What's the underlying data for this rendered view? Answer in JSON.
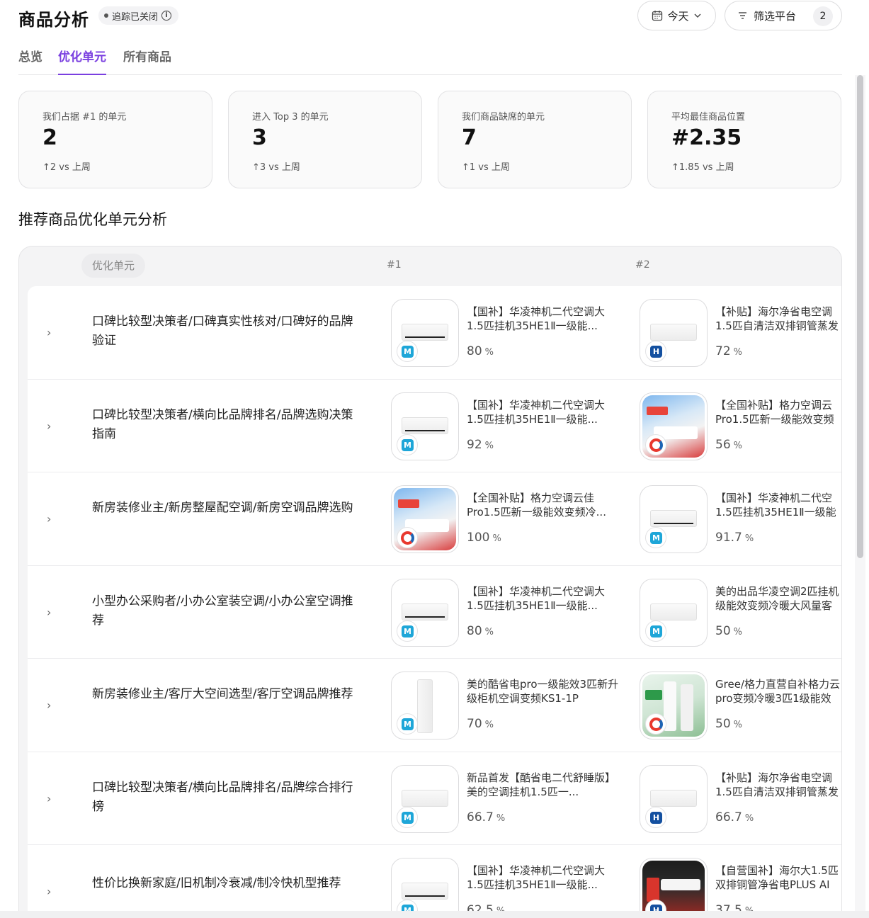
{
  "header": {
    "title": "商品分析",
    "tracking_status": "追踪已关闭",
    "date_filter": "今天",
    "platform_filter": "筛选平台",
    "platform_count": "2"
  },
  "tabs": [
    {
      "label": "总览",
      "active": false
    },
    {
      "label": "优化单元",
      "active": true
    },
    {
      "label": "所有商品",
      "active": false
    }
  ],
  "stats": [
    {
      "label": "我们占据 #1 的单元",
      "value": "2",
      "delta": "↑2 vs 上周"
    },
    {
      "label": "进入 Top 3 的单元",
      "value": "3",
      "delta": "↑3 vs 上周"
    },
    {
      "label": "我们商品缺席的单元",
      "value": "7",
      "delta": "↑1 vs 上周"
    },
    {
      "label": "平均最佳商品位置",
      "value": "#2.35",
      "delta": "↑1.85 vs 上周"
    }
  ],
  "section_title": "推荐商品优化单元分析",
  "table": {
    "col_unit": "优化单元",
    "col_1": "#1",
    "col_2": "#2",
    "rows": [
      {
        "unit": "口碑比较型决策者/口碑真实性核对/口碑好的品牌验证",
        "p1": {
          "title": "【国补】华凌神机二代空调大1.5匹挂机35HE1Ⅱ一级能...",
          "score": "80",
          "pct": "%",
          "brand": "midea",
          "img": "ac"
        },
        "p2": {
          "title": "【补贴】海尔净省电空调1.5匹自清洁双排铜管蒸发",
          "score": "72",
          "pct": "%",
          "brand": "haier",
          "img": "ac-plain"
        }
      },
      {
        "unit": "口碑比较型决策者/横向比品牌排名/品牌选购决策指南",
        "p1": {
          "title": "【国补】华凌神机二代空调大1.5匹挂机35HE1Ⅱ一级能...",
          "score": "92",
          "pct": "%",
          "brand": "midea",
          "img": "ac"
        },
        "p2": {
          "title": "【全国补贴】格力空调云Pro1.5匹新一级能效变频",
          "score": "56",
          "pct": "%",
          "brand": "gree",
          "img": "promo"
        }
      },
      {
        "unit": "新房装修业主/新房整屋配空调/新房空调品牌选购",
        "p1": {
          "title": "【全国补贴】格力空调云佳Pro1.5匹新一级能效变频冷...",
          "score": "100",
          "pct": "%",
          "brand": "gree",
          "img": "promo"
        },
        "p2": {
          "title": "【国补】华凌神机二代空1.5匹挂机35HE1Ⅱ一级能",
          "score": "91.7",
          "pct": "%",
          "brand": "midea",
          "img": "ac"
        }
      },
      {
        "unit": "小型办公采购者/小办公室装空调/小办公室空调推荐",
        "p1": {
          "title": "【国补】华凌神机二代空调大1.5匹挂机35HE1Ⅱ一级能...",
          "score": "80",
          "pct": "%",
          "brand": "midea",
          "img": "ac"
        },
        "p2": {
          "title": "美的出品华凌空调2匹挂机级能效变频冷暖大风量客",
          "score": "50",
          "pct": "%",
          "brand": "midea",
          "img": "ac-plain"
        }
      },
      {
        "unit": "新房装修业主/客厅大空间选型/客厅空调品牌推荐",
        "p1": {
          "title": "美的酷省电pro一级能效3匹新升级柜机空调变频KS1-1P",
          "score": "70",
          "pct": "%",
          "brand": "midea",
          "img": "tower"
        },
        "p2": {
          "title": "Gree/格力直营自补格力云pro变频冷暖3匹1级能效",
          "score": "50",
          "pct": "%",
          "brand": "gree",
          "img": "gree"
        }
      },
      {
        "unit": "口碑比较型决策者/横向比品牌排名/品牌综合排行榜",
        "p1": {
          "title": "新品首发【酷省电二代舒睡版】美的空调挂机1.5匹一...",
          "score": "66.7",
          "pct": "%",
          "brand": "midea",
          "img": "ac-plain"
        },
        "p2": {
          "title": "【补贴】海尔净省电空调1.5匹自清洁双排铜管蒸发",
          "score": "66.7",
          "pct": "%",
          "brand": "haier",
          "img": "ac-plain"
        }
      },
      {
        "unit": "性价比换新家庭/旧机制冷衰减/制冷快机型推荐",
        "p1": {
          "title": "【国补】华凌神机二代空调大1.5匹挂机35HE1Ⅱ一级能...",
          "score": "62.5",
          "pct": "%",
          "brand": "midea",
          "img": "ac"
        },
        "p2": {
          "title": "【自营国补】海尔大1.5匹双排铜管净省电PLUS AI",
          "score": "37.5",
          "pct": "%",
          "brand": "haier",
          "img": "dark"
        }
      }
    ]
  }
}
